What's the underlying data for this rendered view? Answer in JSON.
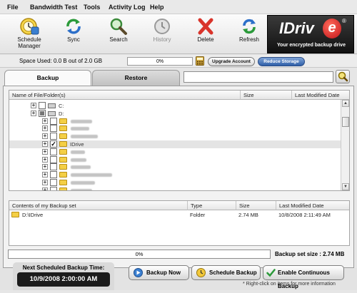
{
  "menu": {
    "items": [
      "File",
      "Bandwidth Test",
      "Tools",
      "Activity Log",
      "Help"
    ]
  },
  "toolbar": {
    "buttons": [
      {
        "label": "Schedule\nManager",
        "icon": "schedule-icon"
      },
      {
        "label": "Sync",
        "icon": "sync-icon"
      },
      {
        "label": "Search",
        "icon": "search-icon"
      },
      {
        "label": "History",
        "icon": "history-icon",
        "disabled": true
      },
      {
        "label": "Delete",
        "icon": "delete-icon"
      },
      {
        "label": "Refresh",
        "icon": "refresh-icon"
      }
    ]
  },
  "logo": {
    "word": "IDriv",
    "e": "e",
    "reg": "®",
    "tagline": "Your encrypted backup drive"
  },
  "space": {
    "label": "Space Used:  0.0 B out of 2.0 GB",
    "progress_text": "0%",
    "progress_value": 0,
    "upgrade_label": "Upgrade Account",
    "reduce_label": "Reduce Storage"
  },
  "tabs": {
    "backup": "Backup",
    "restore": "Restore"
  },
  "search": {
    "value": "",
    "placeholder": ""
  },
  "tree": {
    "columns": {
      "name": "Name of File/Folder(s)",
      "size": "Size",
      "modified": "Last Modified Date"
    },
    "rows": [
      {
        "label": "C:",
        "type": "drive",
        "checked": false
      },
      {
        "label": "D:",
        "type": "drive",
        "checked": "partial"
      },
      {
        "label": "",
        "type": "folder",
        "checked": false,
        "blurred": true
      },
      {
        "label": "",
        "type": "folder",
        "checked": false,
        "blurred": true
      },
      {
        "label": "",
        "type": "folder",
        "checked": false,
        "blurred": true
      },
      {
        "label": "IDrive",
        "type": "folder",
        "checked": true,
        "selected": true
      },
      {
        "label": "",
        "type": "folder",
        "checked": false,
        "blurred": true
      },
      {
        "label": "",
        "type": "folder",
        "checked": false,
        "blurred": true
      },
      {
        "label": "",
        "type": "folder",
        "checked": false,
        "blurred": true
      },
      {
        "label": "",
        "type": "folder",
        "checked": false,
        "blurred": true
      },
      {
        "label": "",
        "type": "folder",
        "checked": false,
        "blurred": true
      },
      {
        "label": "",
        "type": "folder",
        "checked": false,
        "blurred": true
      }
    ]
  },
  "contents": {
    "columns": {
      "name": "Contents of my Backup set",
      "type": "Type",
      "size": "Size",
      "modified": "Last Modified Date"
    },
    "rows": [
      {
        "name": "D:\\IDrive",
        "type": "Folder",
        "size": "2.74 MB",
        "modified": "10/8/2008 2:11:49 AM"
      }
    ]
  },
  "backup_progress": {
    "text": "0%",
    "value": 0
  },
  "backup_set_size": "Backup set size : 2.74 MB",
  "schedule": {
    "title": "Next Scheduled Backup Time:",
    "time": "10/9/2008 2:00:00 AM"
  },
  "actions": {
    "backup_now": "Backup Now",
    "schedule_backup": "Schedule Backup",
    "continuous": "Enable Continuous Backup"
  },
  "footnote": "* Right-click on items for more information",
  "colors": {
    "accent": "#2f5fa8",
    "delete": "#d9342b",
    "logo_red": "#c0141a"
  }
}
